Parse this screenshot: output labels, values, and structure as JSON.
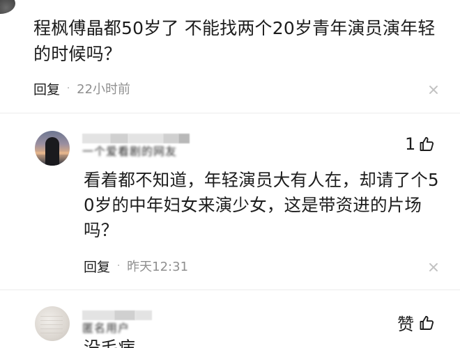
{
  "main_comment": {
    "text": "程枫傅晶都50岁了 不能找两个20岁青年演员演年轻的时候吗？",
    "reply_label": "回复",
    "time": "22小时前"
  },
  "reply": {
    "username": "一个爱看剧的网友",
    "like_count": "1",
    "text": "看着都不知道，年轻演员大有人在，却请了个50岁的中年妇女来演少女，这是带资进的片场吗？",
    "reply_label": "回复",
    "time": "昨天12:31"
  },
  "third_comment": {
    "username": "匿名用户",
    "like_label": "赞",
    "text_preview": "没毛病"
  },
  "icons": {
    "close": "close-icon",
    "like": "thumbs-up-icon",
    "dot": "·"
  },
  "colors": {
    "text": "#1c1c1c",
    "meta": "#8f8f8f",
    "divider": "#ececec"
  }
}
